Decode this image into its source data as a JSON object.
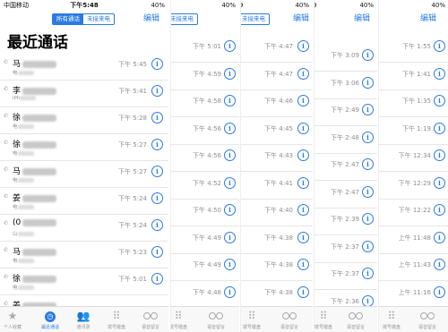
{
  "status": {
    "carrier": "中国移动",
    "time": "下午5:48",
    "battery": "40%",
    "panel_time_fragments": [
      "9",
      "9"
    ]
  },
  "segment": {
    "all": "所有通话",
    "missed": "未接来电"
  },
  "edit_label": "编辑",
  "title": "最近通话",
  "panel1": {
    "rows": [
      {
        "name": "马",
        "sub": "电",
        "time": "下午 5:45"
      },
      {
        "name": "李",
        "sub": "iPh",
        "time": "下午 5:41"
      },
      {
        "name": "徐",
        "sub": "电",
        "time": "下午 5:28"
      },
      {
        "name": "徐",
        "sub": "电",
        "time": "下午 5:27"
      },
      {
        "name": "马",
        "sub": "电",
        "time": "下午 5:27"
      },
      {
        "name": "姜",
        "sub": "电",
        "time": "下午 5:24"
      },
      {
        "name": "(0",
        "sub": "山",
        "time": "下午 5:24"
      },
      {
        "name": "马",
        "sub": "电",
        "time": "下午 5:23"
      },
      {
        "name": "徐",
        "sub": "电",
        "time": "下午 5:01"
      },
      {
        "name": "姜",
        "sub": "",
        "time": ""
      }
    ]
  },
  "panel2_times": [
    "下午 5:01",
    "下午 4:59",
    "下午 4:58",
    "下午 4:56",
    "下午 4:56",
    "下午 4:52",
    "下午 4:50",
    "下午 4:49",
    "下午 4:49",
    "下午 4:48"
  ],
  "panel3_times": [
    "下午 4:47",
    "下午 4:47",
    "下午 4:46",
    "下午 4:45",
    "下午 4:43",
    "下午 4:41",
    "下午 4:40",
    "下午 4:38",
    "下午 4:38",
    "下午 4:38"
  ],
  "panel4_times": [
    "下午 3:09",
    "下午 3:06",
    "下午 2:49",
    "下午 2:48",
    "下午 2:47",
    "下午 2:47",
    "下午 2:39",
    "下午 2:37",
    "下午 2:37",
    "下午 2:36"
  ],
  "panel5_times": [
    "下午 1:55",
    "下午 1:41",
    "下午 1:35",
    "下午 1:19",
    "下午 12:34",
    "下午 12:29",
    "下午 12:22",
    "上午 11:48",
    "上午 11:43",
    "上午 11:16"
  ],
  "tabs": {
    "favorites": "个人收藏",
    "recents": "最近通话",
    "contacts": "通讯录",
    "keypad": "拨号键盘",
    "voicemail": "语音留言"
  },
  "colors": {
    "accent": "#2a7ae2"
  }
}
